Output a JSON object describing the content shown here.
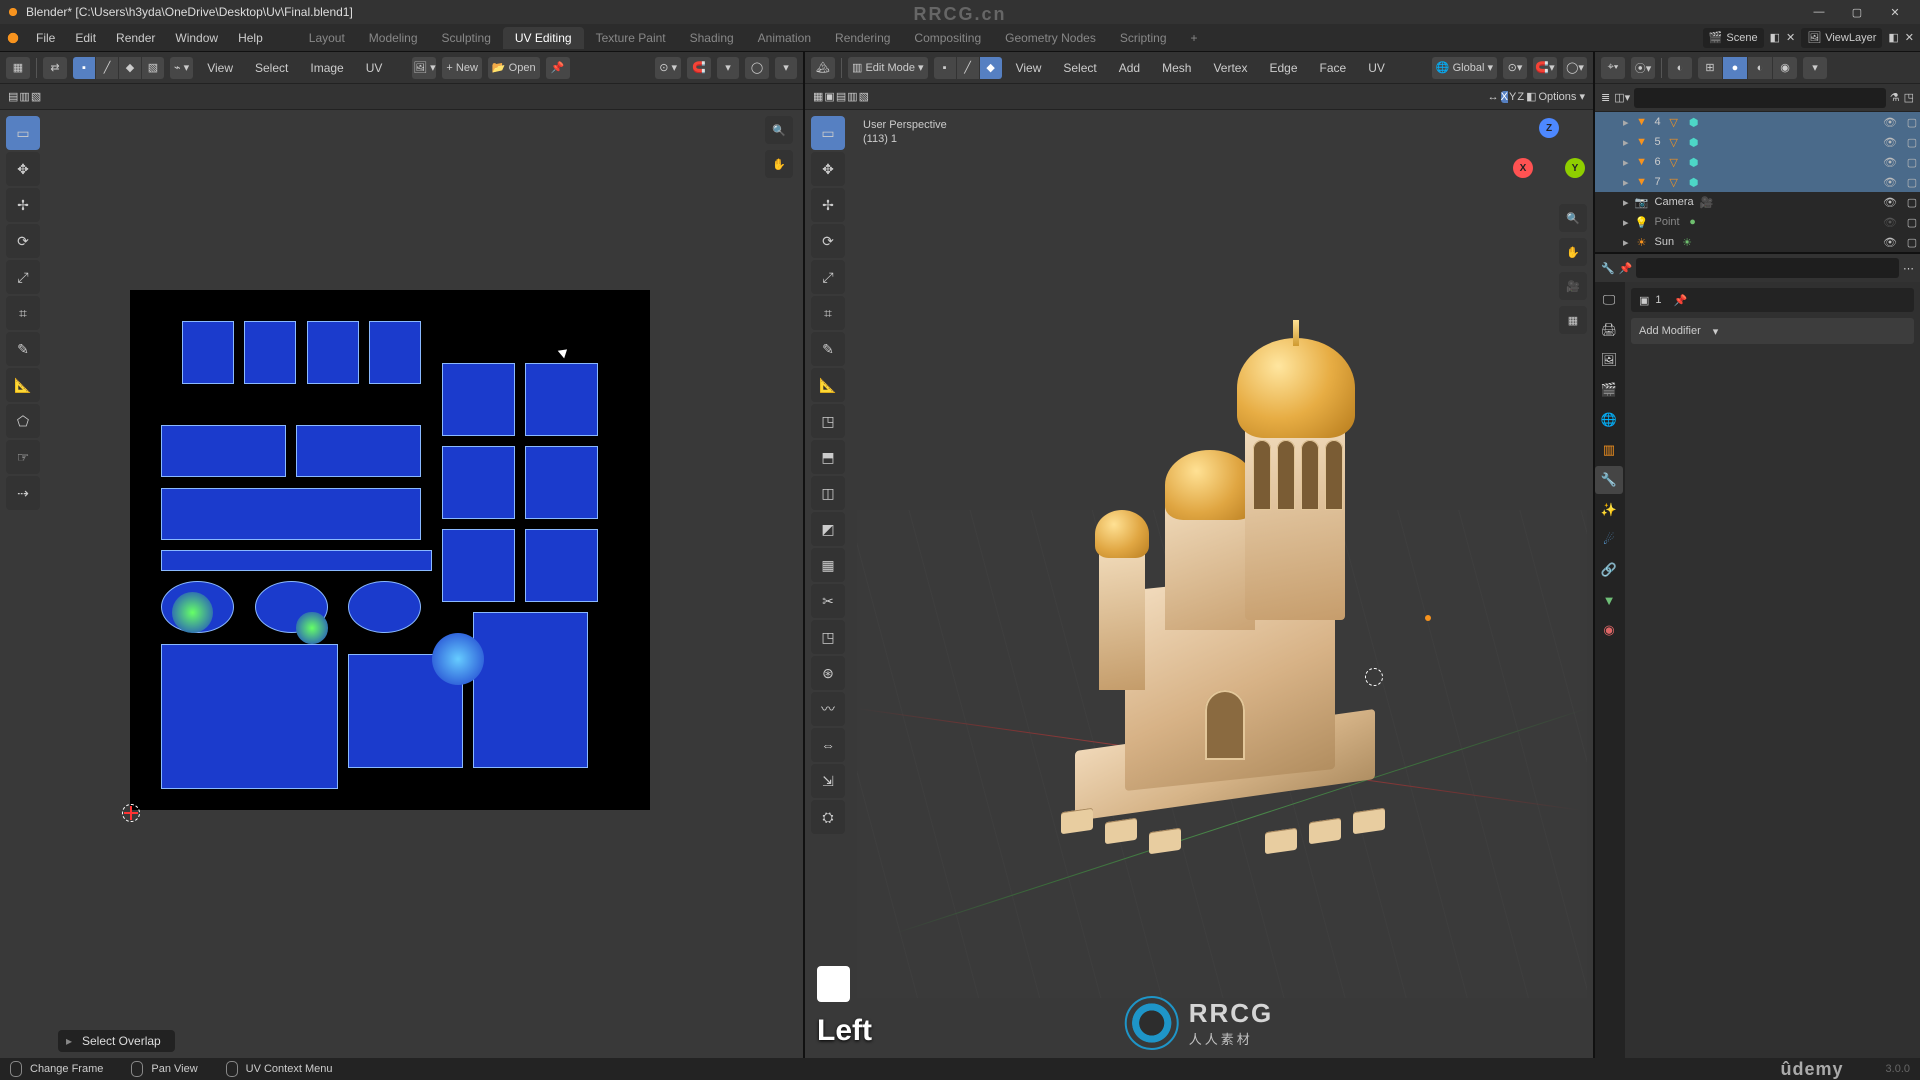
{
  "window": {
    "title": "Blender* [C:\\Users\\h3yda\\OneDrive\\Desktop\\Uv\\Final.blend1]",
    "min": "—",
    "max": "▢",
    "close": "✕"
  },
  "menubar": {
    "file": "File",
    "edit": "Edit",
    "render": "Render",
    "window": "Window",
    "help": "Help",
    "scene_label": "Scene",
    "viewlayer_label": "ViewLayer"
  },
  "watermark_top": "RRCG.cn",
  "workspaces": {
    "tabs": [
      {
        "label": "Layout"
      },
      {
        "label": "Modeling"
      },
      {
        "label": "Sculpting"
      },
      {
        "label": "UV Editing",
        "active": true
      },
      {
        "label": "Texture Paint"
      },
      {
        "label": "Shading"
      },
      {
        "label": "Animation"
      },
      {
        "label": "Rendering"
      },
      {
        "label": "Compositing"
      },
      {
        "label": "Geometry Nodes"
      },
      {
        "label": "Scripting"
      }
    ],
    "add": "+"
  },
  "uv_header": {
    "view": "View",
    "select": "Select",
    "image": "Image",
    "uv": "UV",
    "new": "New",
    "open": "Open",
    "plus": "+"
  },
  "uv_last_op": "Select Overlap",
  "vp_header": {
    "mode": "Edit Mode",
    "view": "View",
    "select": "Select",
    "add": "Add",
    "mesh": "Mesh",
    "vertex": "Vertex",
    "edge": "Edge",
    "face": "Face",
    "uv": "UV",
    "orientation": "Global"
  },
  "vp_info": {
    "persp": "User Perspective",
    "item": "(113) 1"
  },
  "vp_options": "Options",
  "nav": {
    "x": "X",
    "y": "Y",
    "z": "Z"
  },
  "mouse_overlay": "Left",
  "watermark": {
    "ln1": "RRCG",
    "ln2": "人人素材"
  },
  "outliner": {
    "rows": [
      {
        "name": "4",
        "mesh": true,
        "mat": true,
        "sel": true
      },
      {
        "name": "5",
        "mesh": true,
        "mat": true,
        "sel": true
      },
      {
        "name": "6",
        "mesh": true,
        "mat": true,
        "sel": true
      },
      {
        "name": "7",
        "mesh": true,
        "mat": true,
        "sel": true
      },
      {
        "name": "Camera",
        "cam": true
      },
      {
        "name": "Point",
        "light": true
      },
      {
        "name": "Sun",
        "light": true
      }
    ]
  },
  "props": {
    "datalink": "1",
    "add_modifier": "Add Modifier"
  },
  "status": {
    "a": "Change Frame",
    "b": "Pan View",
    "c": "UV Context Menu",
    "version": "3.0.0"
  },
  "udemy": "ûdemy"
}
